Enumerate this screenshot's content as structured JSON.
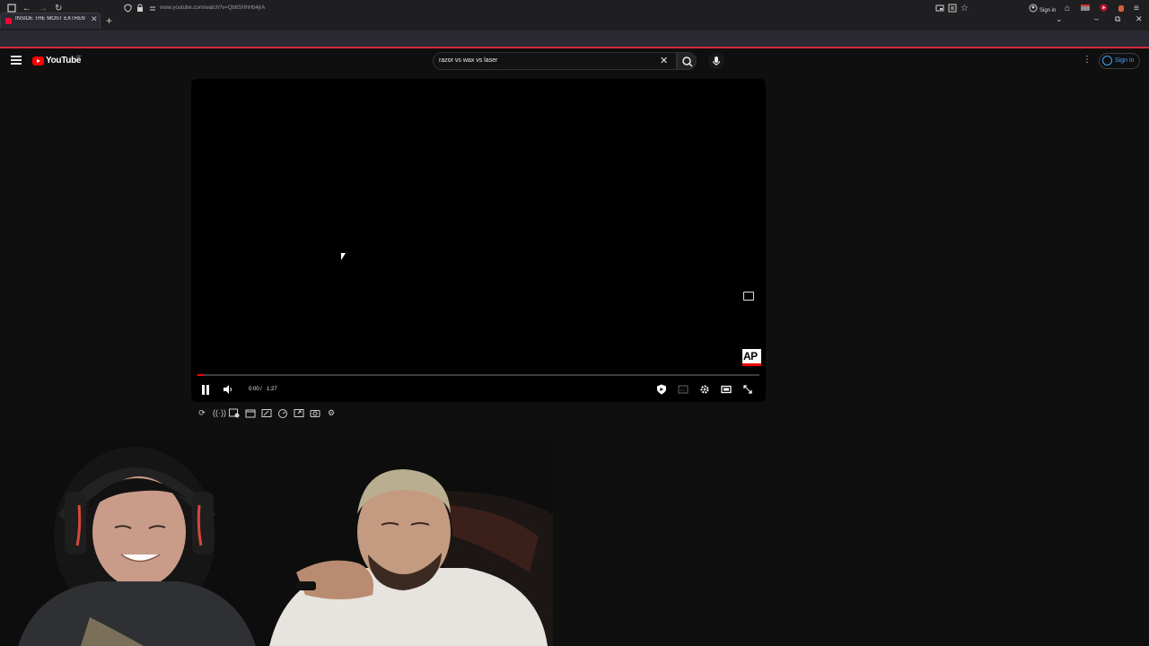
{
  "browser": {
    "tab_title": "INSIDE THE MOST EXTREME AI",
    "tab_close": "✕",
    "new_tab": "+",
    "url": "www.youtube.com/watch?v=Qb6SHhHb4jrA",
    "signin_label": "Sign in",
    "accent_color": "#d9263d"
  },
  "youtube": {
    "logo_text": "YouTube",
    "country_code": "DE",
    "search_query": "razor vs wax vs laser",
    "signin_label": "Sign in",
    "link_color": "#3ea6ff"
  },
  "player": {
    "current_time": "0:00",
    "separator": "/",
    "duration": "1:27",
    "progress_fraction": 0.01,
    "watermark": "AP",
    "state": "playing"
  },
  "icons": {
    "close": "✕",
    "search": "search-icon",
    "mic": "mic-icon",
    "more": "⋮",
    "volume": "🔊"
  }
}
